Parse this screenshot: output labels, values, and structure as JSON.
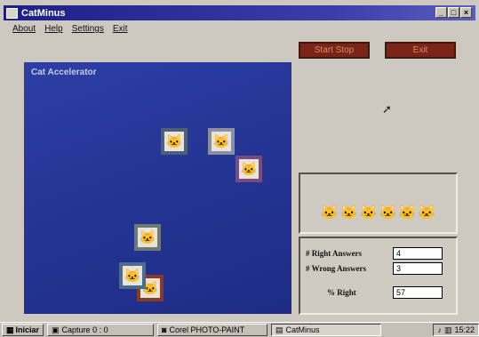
{
  "window": {
    "title": "CatMinus"
  },
  "menu": [
    {
      "label": "About"
    },
    {
      "label": "Help"
    },
    {
      "label": "Settings"
    },
    {
      "label": "Exit"
    }
  ],
  "toolbar": {
    "start_stop_label": "Start Stop",
    "exit_label": "Exit"
  },
  "game": {
    "title": "Cat Accelerator"
  },
  "stats": [
    {
      "label": "# Right Answers",
      "value": "4"
    },
    {
      "label": "# Wrong Answers",
      "value": "3"
    },
    {
      "label": "% Right",
      "value": "57"
    }
  ],
  "remaining_cats": {
    "count": 6
  },
  "taskbar": {
    "start_label": "Iniciar",
    "items": [
      {
        "label": "Capture 0 : 0"
      },
      {
        "label": "Corel PHOTO-PAINT"
      },
      {
        "label": "CatMinus"
      }
    ],
    "clock": "15:22"
  },
  "colors": {
    "title_bar": "#1b1f86",
    "game_bg": "#253696",
    "button_bg": "#7a2316",
    "button_text": "#c9955d"
  },
  "icons": [
    "cat-face-icon",
    "app-icon",
    "mouse-pointer-icon"
  ]
}
